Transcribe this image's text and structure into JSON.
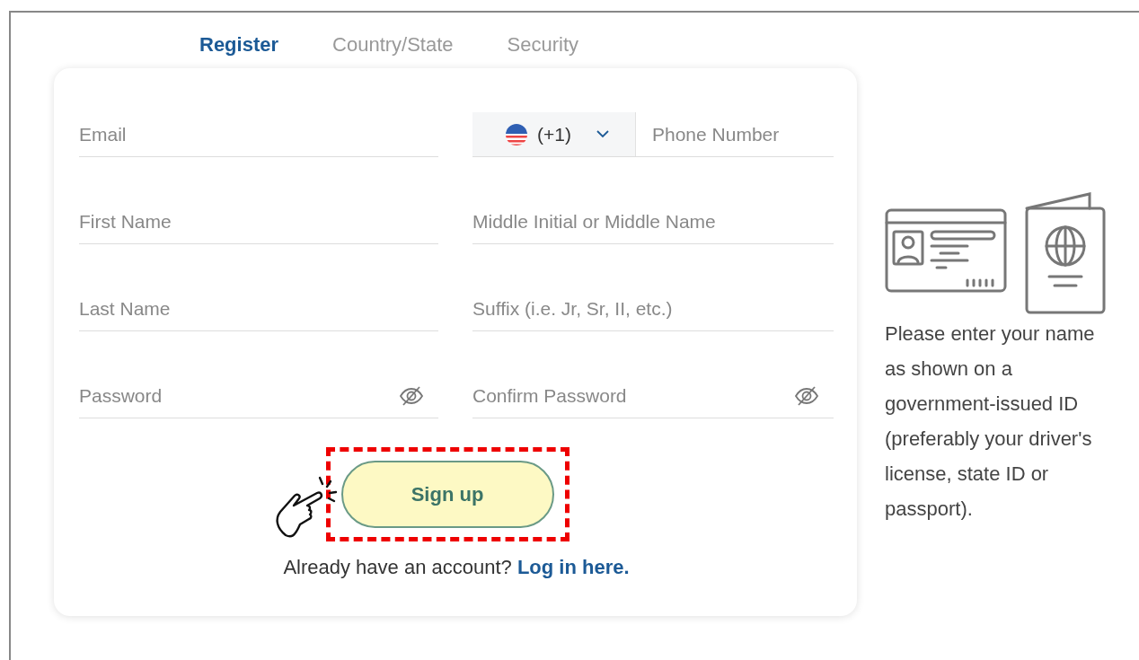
{
  "tabs": [
    {
      "label": "Register",
      "selected": true
    },
    {
      "label": "Country/State",
      "selected": false
    },
    {
      "label": "Security",
      "selected": false
    }
  ],
  "form": {
    "fields": [
      {
        "kind": "text",
        "placeholder": "Email"
      },
      {
        "kind": "phone",
        "code": "(+1)",
        "placeholder": "Phone Number"
      },
      {
        "kind": "text",
        "placeholder": "First Name"
      },
      {
        "kind": "text",
        "placeholder": "Middle Initial or Middle Name"
      },
      {
        "kind": "text",
        "placeholder": "Last Name"
      },
      {
        "kind": "text",
        "placeholder": "Suffix (i.e. Jr, Sr, II, etc.)"
      },
      {
        "kind": "password",
        "placeholder": "Password"
      },
      {
        "kind": "password",
        "placeholder": "Confirm Password"
      }
    ],
    "submit": {
      "label": "Sign up",
      "highlighted": true
    },
    "login_prompt": "Already have an account?",
    "login_link": "Log in here."
  },
  "aside": {
    "text": "Please enter your name as shown on a government-issued ID (preferably your driver's license, state ID or passport)."
  }
}
